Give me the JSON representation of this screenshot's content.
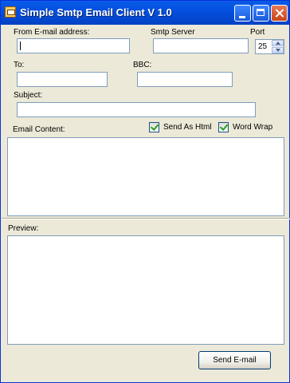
{
  "window": {
    "title": "Simple Smtp Email Client V 1.0"
  },
  "form": {
    "from_label": "From E-mail address:",
    "from_value": "",
    "smtp_label": "Smtp Server",
    "smtp_value": "",
    "port_label": "Port",
    "port_value": "25",
    "to_label": "To:",
    "to_value": "",
    "bbc_label": "BBC:",
    "bbc_value": "",
    "subject_label": "Subject:",
    "subject_value": "",
    "content_label": "Email Content:",
    "send_as_html_label": "Send As Html",
    "send_as_html_checked": true,
    "word_wrap_label": "Word Wrap",
    "word_wrap_checked": true,
    "content_value": "",
    "preview_label": "Preview:",
    "preview_value": ""
  },
  "actions": {
    "send_label": "Send E-mail"
  },
  "icons": [
    "app-icon",
    "minimize-icon",
    "maximize-icon",
    "close-icon",
    "spin-up-icon",
    "spin-down-icon",
    "checkmark-icon"
  ]
}
